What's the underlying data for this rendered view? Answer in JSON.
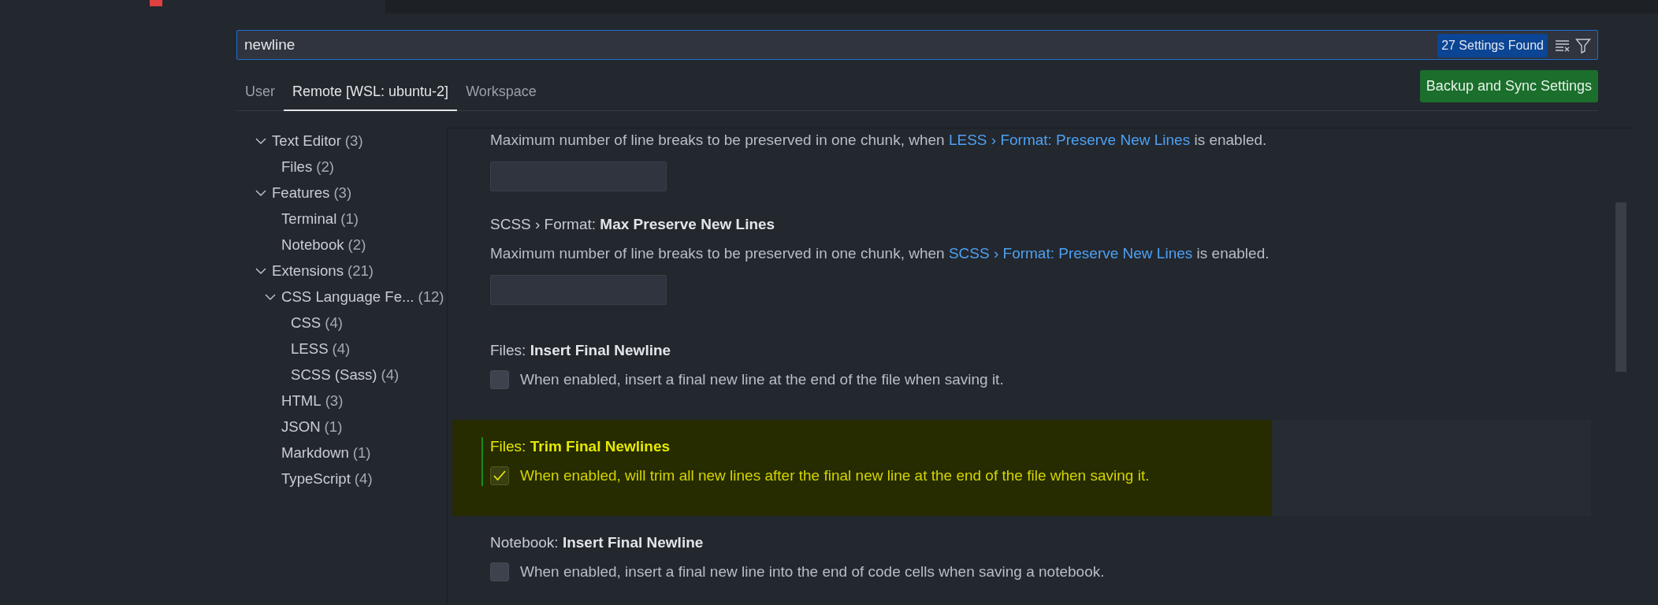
{
  "search": {
    "value": "newline",
    "result_count": "27 Settings Found"
  },
  "tabs": [
    {
      "label": "User",
      "selected": false
    },
    {
      "label": "Remote [WSL: ubuntu-2]",
      "selected": true
    },
    {
      "label": "Workspace",
      "selected": false
    }
  ],
  "sync_button": "Backup and Sync Settings",
  "sidebar": {
    "items": [
      {
        "label": "Text Editor",
        "count": "(3)",
        "expanded": true,
        "children": [
          {
            "label": "Files",
            "count": "(2)"
          }
        ]
      },
      {
        "label": "Features",
        "count": "(3)",
        "expanded": true,
        "children": [
          {
            "label": "Terminal",
            "count": "(1)"
          },
          {
            "label": "Notebook",
            "count": "(2)"
          }
        ]
      },
      {
        "label": "Extensions",
        "count": "(21)",
        "expanded": true,
        "children": [
          {
            "label": "CSS Language Fe...",
            "count": "(12)",
            "expanded": true,
            "children": [
              {
                "label": "CSS",
                "count": "(4)"
              },
              {
                "label": "LESS",
                "count": "(4)"
              },
              {
                "label": "SCSS (Sass)",
                "count": "(4)"
              }
            ]
          },
          {
            "label": "HTML",
            "count": "(3)"
          },
          {
            "label": "JSON",
            "count": "(1)"
          },
          {
            "label": "Markdown",
            "count": "(1)"
          },
          {
            "label": "TypeScript",
            "count": "(4)"
          }
        ]
      }
    ]
  },
  "settings": [
    {
      "kind": "number",
      "description": "Maximum number of line breaks to be preserved in one chunk, when ",
      "link": "LESS › Format: Preserve New Lines",
      "description_after": " is enabled.",
      "focused": false
    },
    {
      "kind": "number",
      "category": "SCSS › Format: ",
      "name": "Max Preserve New Lines",
      "description": "Maximum number of line breaks to be preserved in one chunk, when ",
      "link": "SCSS › Format: Preserve New Lines",
      "description_after": " is enabled.",
      "focused": false
    },
    {
      "kind": "checkbox",
      "category": "Files: ",
      "name": "Insert Final Newline",
      "description": "When enabled, insert a final new line at the end of the file when saving it.",
      "checked": false,
      "focused": false
    },
    {
      "kind": "checkbox",
      "category": "Files: ",
      "name": "Trim Final Newlines",
      "description": "When enabled, will trim all new lines after the final new line at the end of the file when saving it.",
      "checked": true,
      "focused": true
    },
    {
      "kind": "checkbox",
      "category": "Notebook: ",
      "name": "Insert Final Newline",
      "description": "When enabled, insert a final new line into the end of code cells when saving a notebook.",
      "checked": false,
      "focused": false
    }
  ]
}
